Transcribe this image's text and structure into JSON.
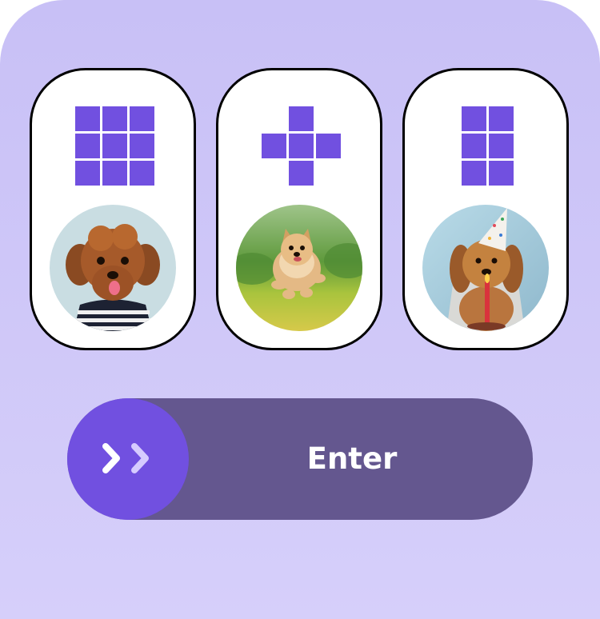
{
  "colors": {
    "background_top": "#c8c0f6",
    "background_bottom": "#d6cffa",
    "accent": "#7150e0",
    "slider_track": "#64578f",
    "card_border": "#000000"
  },
  "cards": [
    {
      "pattern": "grid-3x3",
      "icon": "grid-3x3-icon",
      "photo": "toy-poodle-striped-shirt-photo"
    },
    {
      "pattern": "plus-cross",
      "icon": "plus-cross-icon",
      "photo": "pomeranian-running-on-grass-photo"
    },
    {
      "pattern": "grid-2x3",
      "icon": "grid-2x3-icon",
      "photo": "dog-with-party-hat-and-candle-photo"
    }
  ],
  "slider": {
    "label": "Enter",
    "knob_icon": "double-chevron-right-icon"
  }
}
